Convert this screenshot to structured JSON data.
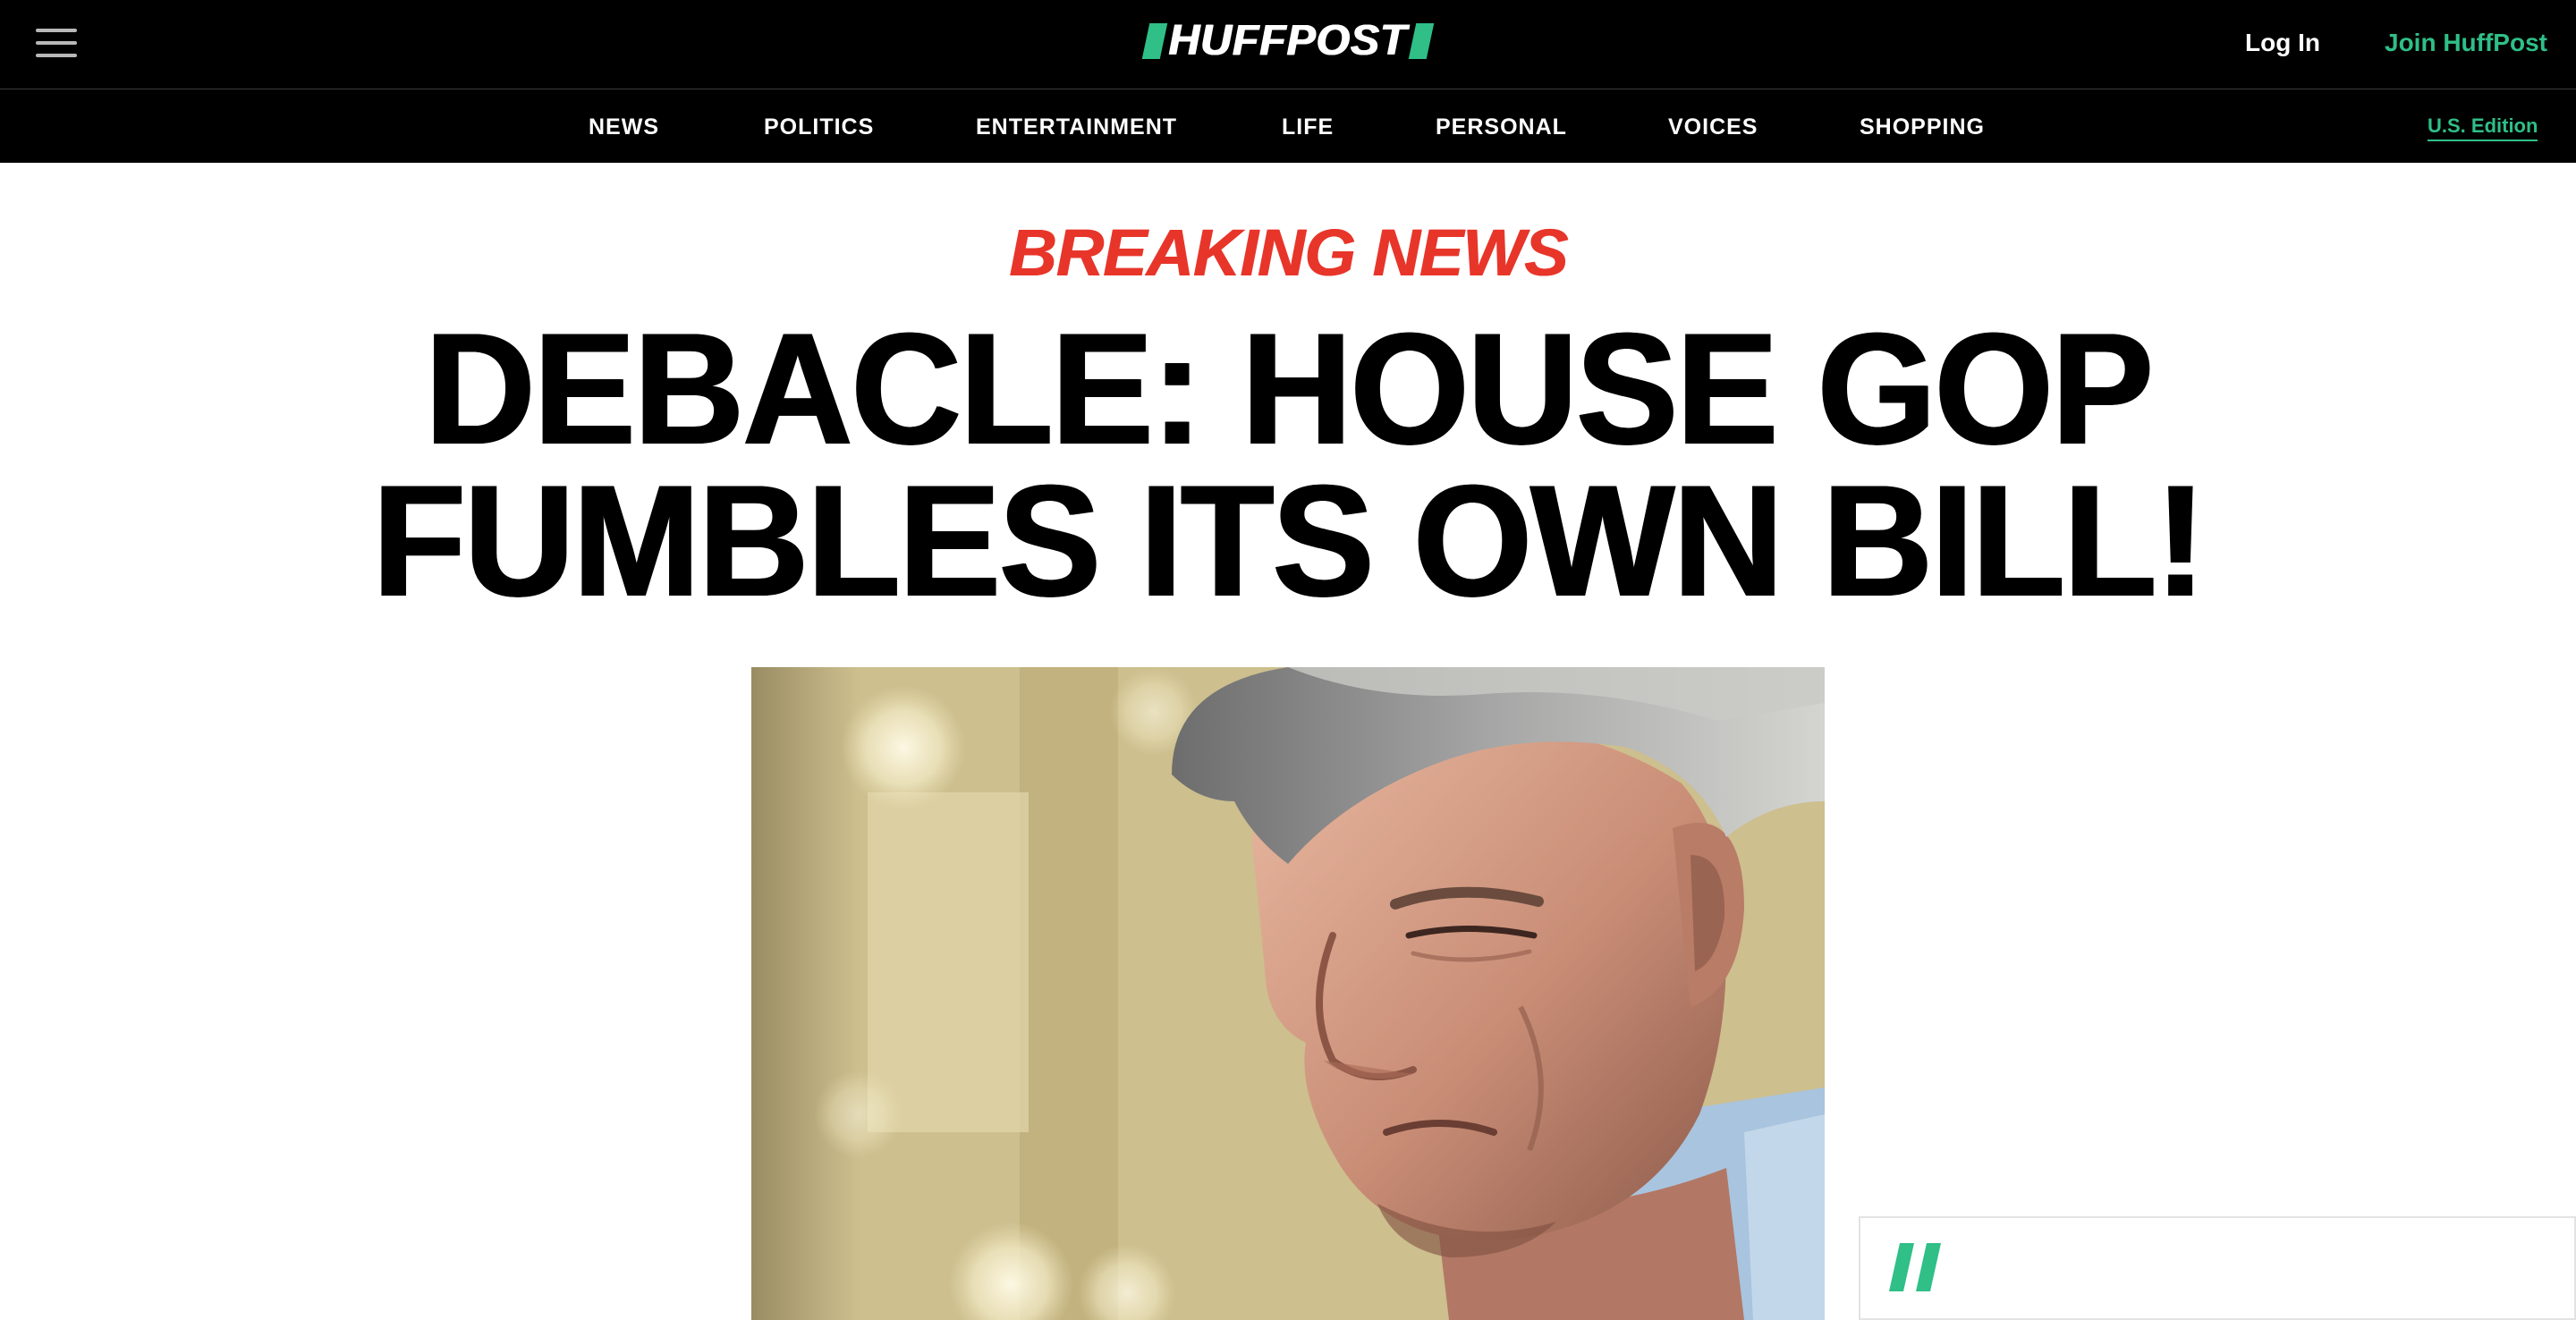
{
  "header": {
    "logo_text": "HUFFPOST",
    "login_label": "Log In",
    "join_label": "Join HuffPost"
  },
  "nav": {
    "items": [
      "NEWS",
      "POLITICS",
      "ENTERTAINMENT",
      "LIFE",
      "PERSONAL",
      "VOICES",
      "SHOPPING"
    ],
    "edition_label": "U.S. Edition"
  },
  "article": {
    "kicker": "BREAKING NEWS",
    "headline_line1": "DEBACLE: HOUSE GOP",
    "headline_line2": "FUMBLES ITS OWN BILL!"
  },
  "icons": {
    "menu": "hamburger-menu-icon",
    "corner": "huffpost-slash-icon"
  },
  "colors": {
    "brand_green": "#2fbf87",
    "breaking_red": "#e8352a",
    "nav_background": "#000000"
  }
}
